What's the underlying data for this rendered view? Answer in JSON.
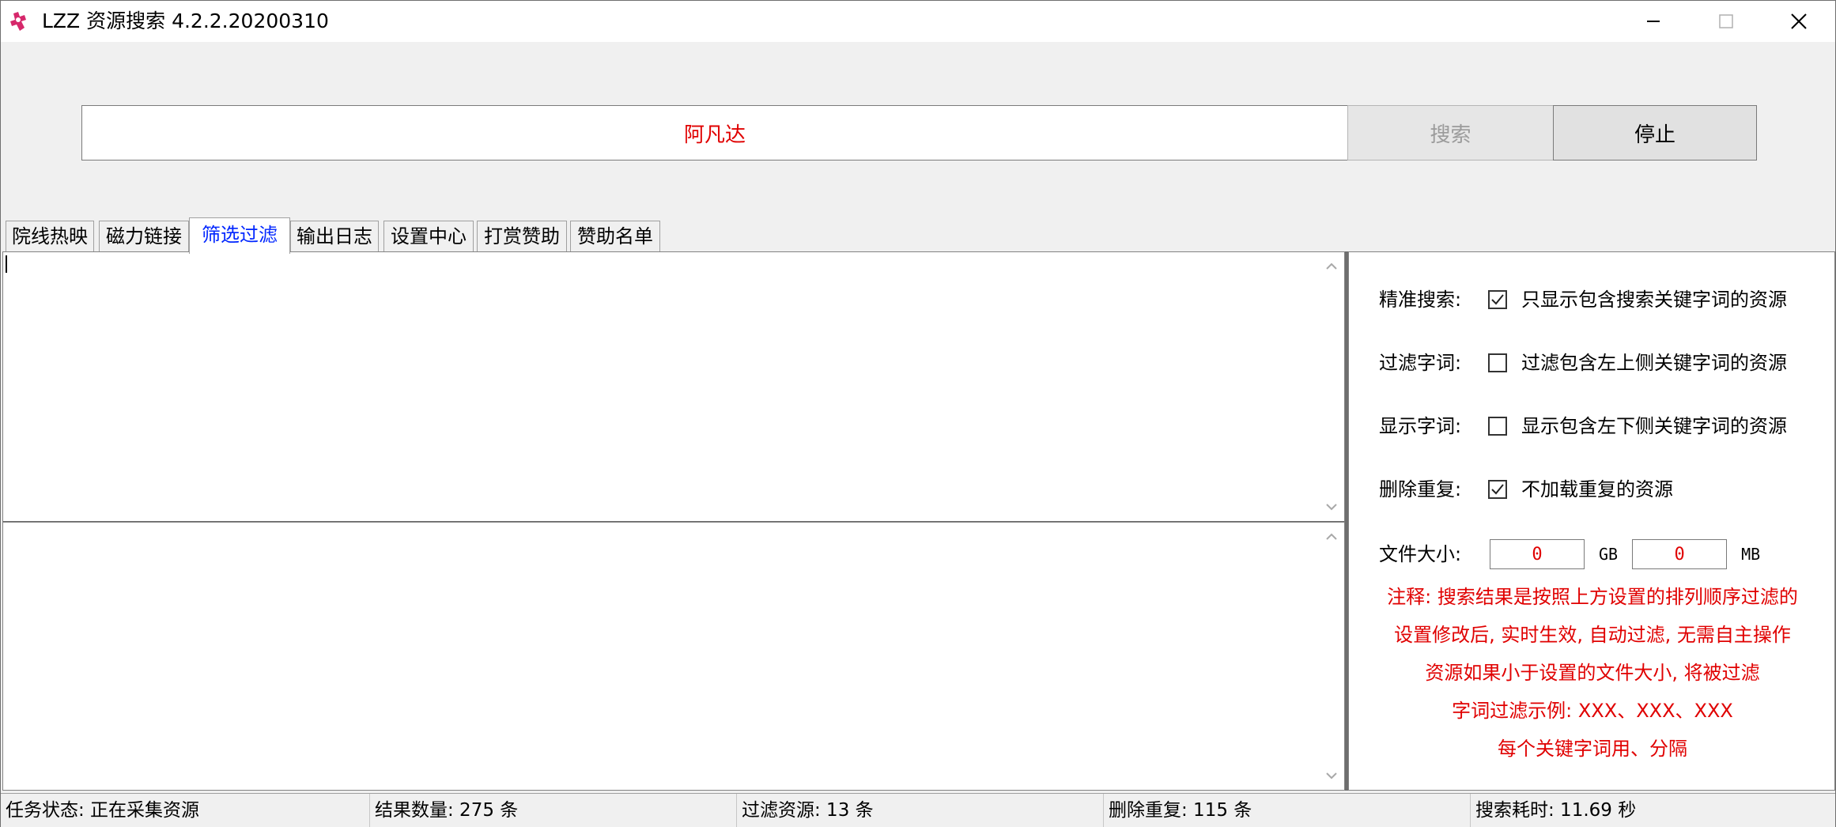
{
  "window": {
    "title": "LZZ 资源搜索 4.2.2.20200310",
    "icon": "app-logo-icon"
  },
  "search": {
    "value": "阿凡达",
    "search_label": "搜索",
    "stop_label": "停止"
  },
  "tabs": [
    {
      "label": "院线热映"
    },
    {
      "label": "磁力链接"
    },
    {
      "label": "筛选过滤",
      "active": true
    },
    {
      "label": "输出日志"
    },
    {
      "label": "设置中心"
    },
    {
      "label": "打赏赞助"
    },
    {
      "label": "赞助名单"
    }
  ],
  "filter": {
    "exact": {
      "label": "精准搜索:",
      "checked": true,
      "text": "只显示包含搜索关键字词的资源"
    },
    "exclude": {
      "label": "过滤字词:",
      "checked": false,
      "text": "过滤包含左上侧关键字词的资源"
    },
    "include": {
      "label": "显示字词:",
      "checked": false,
      "text": "显示包含左下侧关键字词的资源"
    },
    "dedupe": {
      "label": "删除重复:",
      "checked": true,
      "text": "不加载重复的资源"
    },
    "size": {
      "label": "文件大小:",
      "gb_value": "0",
      "gb_unit": "GB",
      "mb_value": "0",
      "mb_unit": "MB"
    },
    "notes": [
      "注释: 搜索结果是按照上方设置的排列顺序过滤的",
      "设置修改后, 实时生效, 自动过滤, 无需自主操作",
      "资源如果小于设置的文件大小, 将被过滤",
      "字词过滤示例: XXX、XXX、XXX",
      "每个关键字词用、分隔"
    ]
  },
  "status": {
    "task": "任务状态: 正在采集资源",
    "results": "结果数量: 275 条",
    "filtered": "过滤资源: 13 条",
    "duplicates": "删除重复: 115 条",
    "elapsed": "搜索耗时: 11.69 秒"
  },
  "colors": {
    "accent_red": "#e00000",
    "active_tab": "#0026ff",
    "disabled_text": "#9b9b9b"
  }
}
